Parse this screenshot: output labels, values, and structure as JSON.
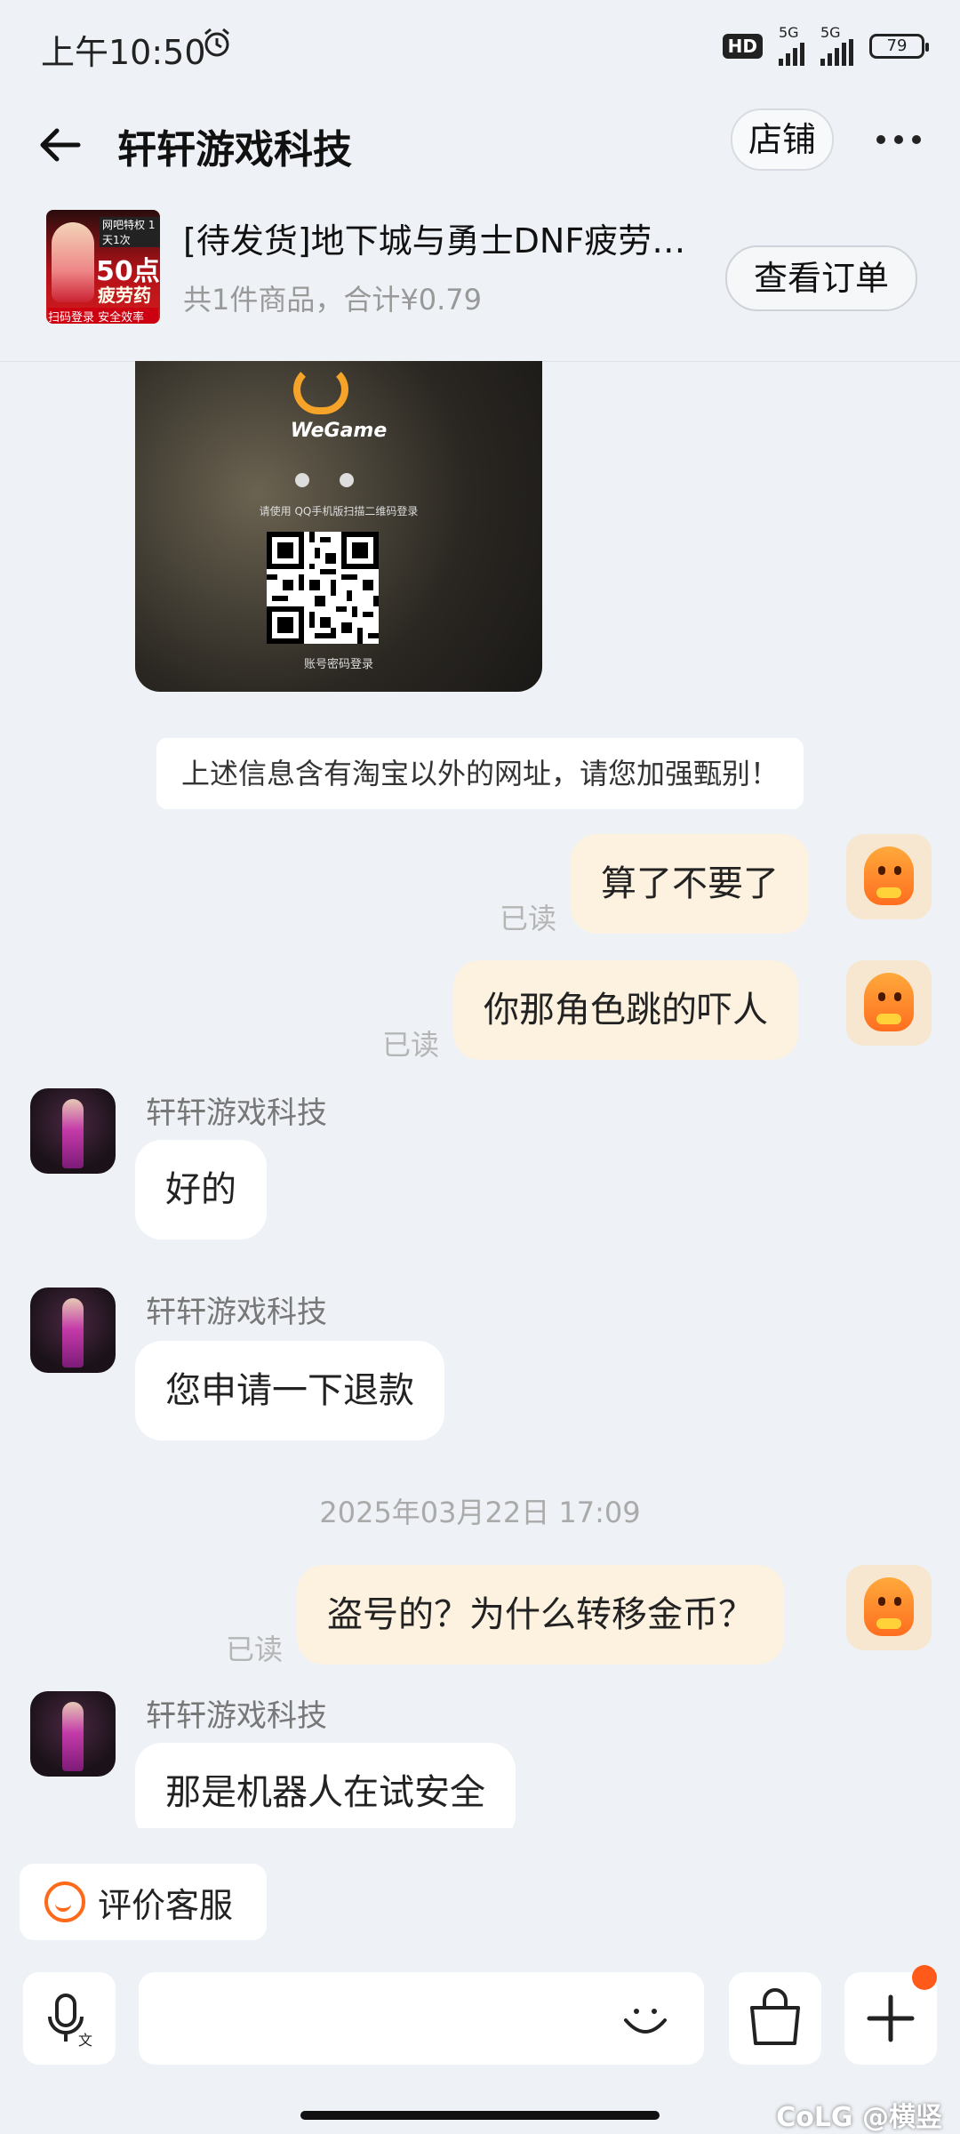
{
  "status_bar": {
    "time": "上午10:50",
    "hd": "HD",
    "network1": "5G",
    "network2": "5G",
    "battery": "79"
  },
  "header": {
    "title": "轩轩游戏科技",
    "shop_button": "店铺"
  },
  "order": {
    "title": "[待发货]地下城与勇士DNF疲劳…",
    "summary": "共1件商品，合计¥0.79",
    "view_button": "查看订单",
    "thumb_badge": "网吧特权 1天1次",
    "thumb_big": "50点",
    "thumb_mid": "疲劳药",
    "thumb_foot": "扫码登录 安全效率"
  },
  "qr_card": {
    "brand": "WeGame",
    "hint": "请使用 QQ手机版扫描二维码登录",
    "footer": "账号密码登录"
  },
  "notice": "上述信息含有淘宝以外的网址，请您加强甄别！",
  "messages": {
    "m1": {
      "text": "算了不要了",
      "status": "已读"
    },
    "m2": {
      "text": "你那角色跳的吓人",
      "status": "已读"
    },
    "m3": {
      "sender": "轩轩游戏科技",
      "text": "好的"
    },
    "m4": {
      "sender": "轩轩游戏科技",
      "text": "您申请一下退款"
    },
    "timestamp": "2025年03月22日 17:09",
    "m5": {
      "text": "盗号的？为什么转移金币？",
      "status": "已读"
    },
    "m6": {
      "sender": "轩轩游戏科技",
      "text": "那是机器人在试安全"
    }
  },
  "review_button": "评价客服",
  "input": {
    "placeholder": "",
    "icons": [
      "voice-to-text-icon",
      "emoji-icon",
      "shopping-bag-icon",
      "plus-icon"
    ]
  },
  "watermark": "CoLG @横竖",
  "colors": {
    "bubble_me": "#fdf1df",
    "accent": "#ff6a1a",
    "background": "#eef1f5"
  }
}
